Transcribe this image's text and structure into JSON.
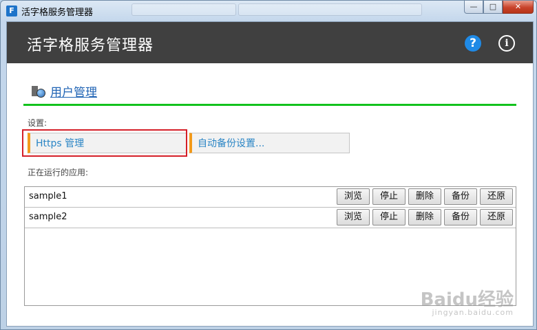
{
  "window": {
    "title": "活字格服务管理器",
    "icon_glyph": "F",
    "controls": {
      "minimize": "—",
      "maximize": "□",
      "close": "✕"
    }
  },
  "header": {
    "title": "活字格服务管理器",
    "help_glyph": "?",
    "info_glyph": "i"
  },
  "user_management": {
    "label": "用户管理"
  },
  "settings": {
    "label": "设置:",
    "buttons": [
      {
        "label": "Https 管理",
        "highlighted": true
      },
      {
        "label": "自动备份设置..."
      }
    ]
  },
  "running_apps": {
    "label": "正在运行的应用:",
    "action_labels": [
      "浏览",
      "停止",
      "删除",
      "备份",
      "还原"
    ],
    "apps": [
      {
        "name": "sample1"
      },
      {
        "name": "sample2"
      }
    ]
  },
  "colors": {
    "header_bg": "#404040",
    "accent_green": "#12c21c",
    "accent_orange": "#f39a1a",
    "link_blue": "#1f63b4",
    "highlight_red": "#d41e27"
  },
  "watermark": {
    "brand": "Baidu经验",
    "url": "jingyan.baidu.com"
  }
}
